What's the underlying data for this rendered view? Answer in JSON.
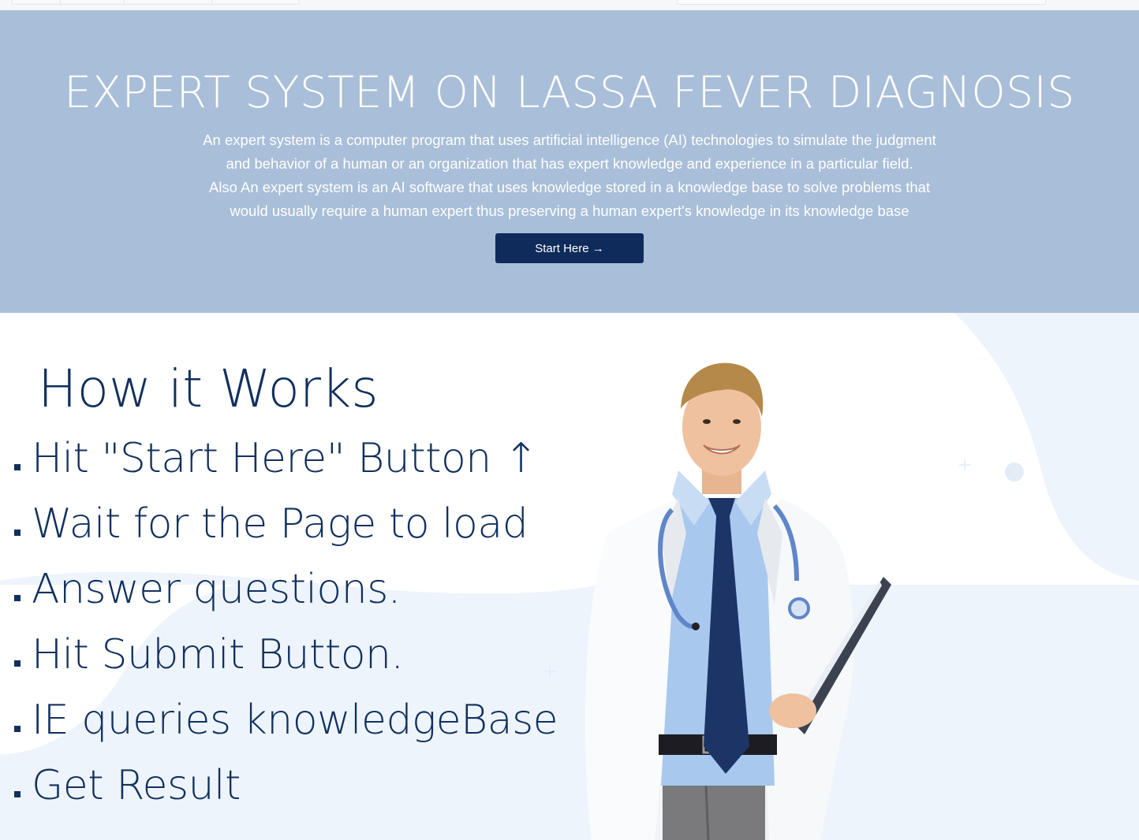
{
  "hero": {
    "title": "EXPERT SYSTEM ON LASSA FEVER DIAGNOSIS",
    "description_lines": [
      "An expert system is a computer program that uses artificial intelligence (AI) technologies to simulate the judgment",
      "and behavior of a human or an organization that has expert knowledge and experience in a particular field.",
      "Also An expert system is an AI software that uses knowledge stored in a knowledge base to solve problems that",
      "would usually require a human expert thus preserving a human expert's knowledge in its knowledge base"
    ],
    "start_button_label": "Start Here →"
  },
  "how_it_works": {
    "title": "How it Works",
    "steps": [
      "Hit \"Start Here\" Button ↑",
      "Wait for the Page to load",
      "Answer questions.",
      "Hit Submit Button.",
      "IE queries knowledgeBase",
      "Get Result"
    ]
  },
  "colors": {
    "hero_bg": "#a9bed8",
    "button_bg": "#0f2b5b",
    "heading_text": "#11305e",
    "decor_bg": "#eef4fb"
  },
  "icons": {
    "doctor_illustration": "doctor-illustration",
    "step_bullet": "square-bullet"
  }
}
